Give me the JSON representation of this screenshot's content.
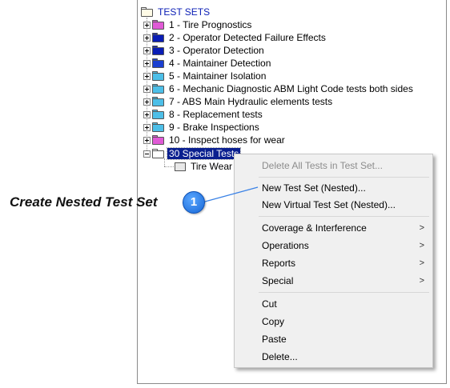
{
  "tree": {
    "root_label": "TEST SETS",
    "items": [
      {
        "label": "1 - Tire Prognostics",
        "folder_color": "#e05ad6"
      },
      {
        "label": "2 - Operator Detected Failure Effects",
        "folder_color": "#0a1db5"
      },
      {
        "label": "3 - Operator Detection",
        "folder_color": "#0a1db5"
      },
      {
        "label": "4 - Maintainer Detection",
        "folder_color": "#1a3fd0"
      },
      {
        "label": "5 - Maintainer Isolation",
        "folder_color": "#4dbfe8"
      },
      {
        "label": "6 - Mechanic Diagnostic ABM Light Code tests both sides",
        "folder_color": "#4dbfe8"
      },
      {
        "label": "7 - ABS Main Hydraulic elements tests",
        "folder_color": "#4dbfe8"
      },
      {
        "label": "8 - Replacement tests",
        "folder_color": "#4dbfe8"
      },
      {
        "label": "9 - Brake Inspections",
        "folder_color": "#4dbfe8"
      },
      {
        "label": "10 - Inspect hoses for wear",
        "folder_color": "#e05ad6"
      }
    ],
    "selected": {
      "label": "30 Special Tests"
    },
    "child": {
      "label": "Tire Wear"
    }
  },
  "context_menu": {
    "delete_all": "Delete All Tests in Test Set...",
    "new_test_set": "New Test Set (Nested)...",
    "new_virtual": "New Virtual Test Set (Nested)...",
    "coverage": "Coverage & Interference",
    "operations": "Operations",
    "reports": "Reports",
    "special": "Special",
    "cut": "Cut",
    "copy": "Copy",
    "paste": "Paste",
    "delete": "Delete...",
    "submenu_arrow": ">"
  },
  "annotation": {
    "callout_text": "Create Nested Test Set",
    "badge_number": "1",
    "badge_color": "#1f6fe0"
  }
}
